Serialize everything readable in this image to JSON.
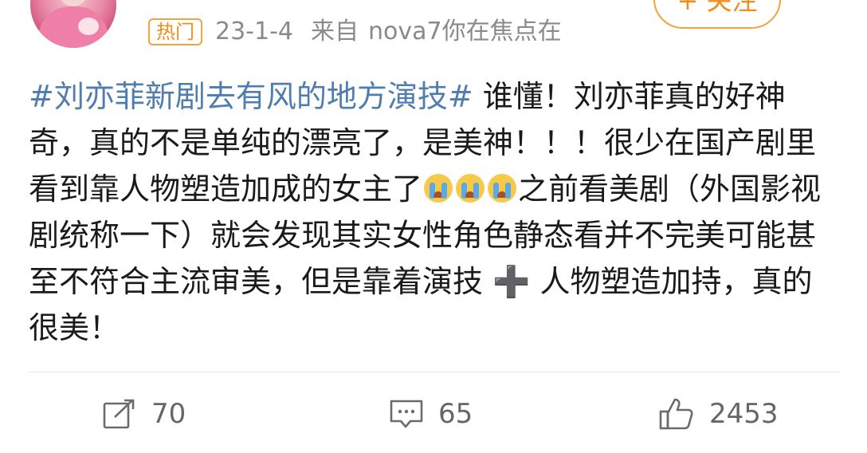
{
  "header": {
    "hot_badge": "热门",
    "date": "23-1-4",
    "from_label": "来自",
    "device": "nova7你在焦点在",
    "follow_label": "+ 关注"
  },
  "post": {
    "hashtag": "#刘亦菲新剧去有风的地方演技#",
    "text_part1": " 谁懂！刘亦菲真的好神奇，真的不是单纯的漂亮了，是美神！！！很少在国产剧里看到靠人物塑造加成的女主了",
    "text_part2": "之前看美剧（外国影视剧统称一下）就会发现其实女性角色静态看并不完美可能甚至不符合主流审美，但是靠着演技",
    "plus_symbol": "➕",
    "text_part3": "人物塑造加持，真的很美！",
    "emojis": [
      "crying-emoji",
      "crying-emoji",
      "crying-emoji"
    ]
  },
  "actions": {
    "repost_count": "70",
    "comment_count": "65",
    "like_count": "2453"
  },
  "colors": {
    "hashtag": "#507daf",
    "accent_orange": "#f08c1b",
    "meta_gray": "#8a8a8a",
    "text": "#1a1a1a"
  },
  "icons": {
    "repost": "repost-icon",
    "comment": "comment-icon",
    "like": "thumbs-up-icon"
  }
}
